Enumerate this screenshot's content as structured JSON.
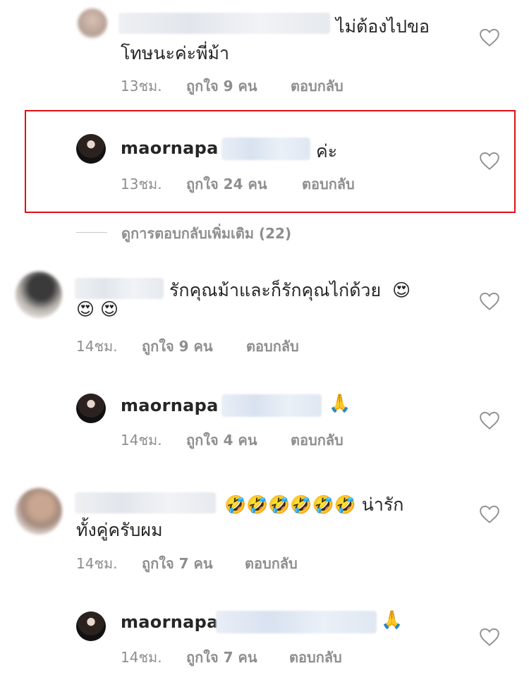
{
  "comments": [
    {
      "id": "c1",
      "username": "",
      "text_lines": [
        "ไม่ต้องไปขอ",
        "โทษนะค่ะพี่ม้า"
      ],
      "time": "13ชม.",
      "likes": "ถูกใจ 9 คน",
      "reply_label": "ตอบกลับ"
    },
    {
      "id": "c2",
      "username": "maornapa",
      "text": "ค่ะ",
      "time": "13ชม.",
      "likes": "ถูกใจ 24 คน",
      "reply_label": "ตอบกลับ"
    },
    {
      "id": "more",
      "label": "ดูการตอบกลับเพิ่มเติม (22)"
    },
    {
      "id": "c3",
      "username": "",
      "text": "รักคุณม้าและก็รักคุณไก่ด้วย",
      "emoji_line1": "😍",
      "emoji_line2": "😍 😍",
      "time": "14ชม.",
      "likes": "ถูกใจ 9 คน",
      "reply_label": "ตอบกลับ"
    },
    {
      "id": "c4",
      "username": "maornapa",
      "emoji": "🙏",
      "time": "14ชม.",
      "likes": "ถูกใจ 4 คน",
      "reply_label": "ตอบกลับ"
    },
    {
      "id": "c5",
      "username": "",
      "emojis": "🤣🤣🤣🤣🤣🤣",
      "text_line1": "น่ารัก",
      "text_line2": "ทั้งคู่ครับผม",
      "time": "14ชม.",
      "likes": "ถูกใจ 7 คน",
      "reply_label": "ตอบกลับ"
    },
    {
      "id": "c6",
      "username": "maornapa",
      "emoji": "🙏",
      "time": "14ชม.",
      "likes": "ถูกใจ 7 คน",
      "reply_label": "ตอบกลับ"
    }
  ],
  "colors": {
    "highlight_border": "#e10f17",
    "meta_text": "#8e8e8e",
    "primary_text": "#262626"
  }
}
